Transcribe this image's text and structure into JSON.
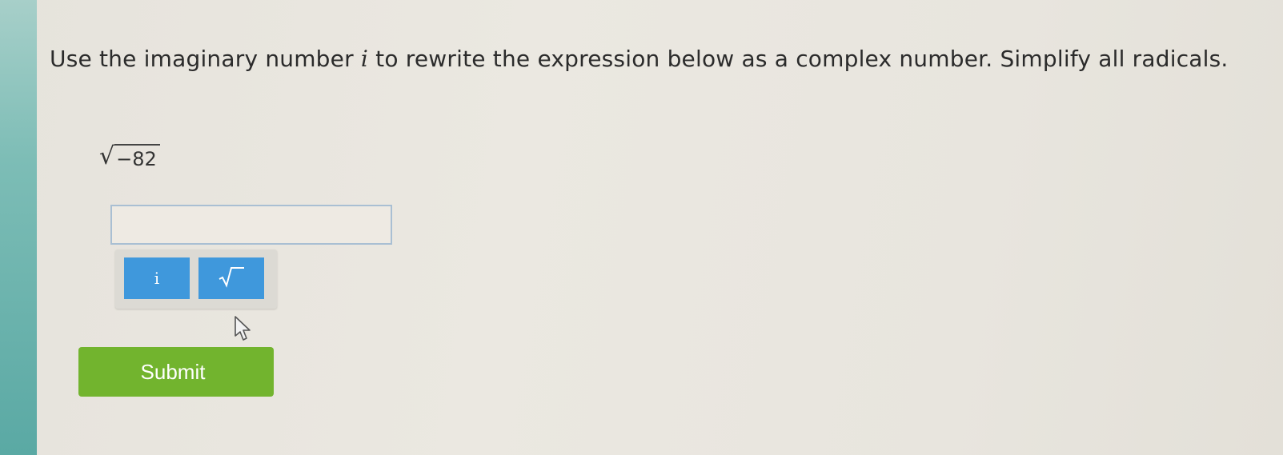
{
  "question": {
    "part1": "Use the imaginary number ",
    "imaginary_symbol": "i",
    "part2": " to rewrite the expression below as a complex number. Simplify all radicals."
  },
  "expression": {
    "radical_symbol": "√",
    "radicand": "−82"
  },
  "answer": {
    "value": ""
  },
  "tools": {
    "i_label": "i",
    "sqrt_label": "√‾"
  },
  "submit": {
    "label": "Submit"
  },
  "colors": {
    "tool_button": "#3f98dc",
    "submit_button": "#72b42e",
    "left_strip": "#5aa9a4"
  },
  "icons": {
    "cursor": "mouse-pointer-icon"
  }
}
